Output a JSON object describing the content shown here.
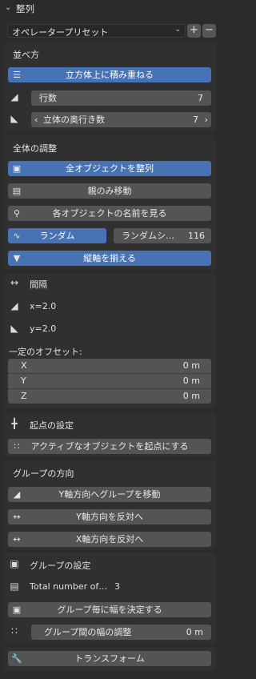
{
  "header": {
    "title": "整列",
    "chevron": "chevron-down-icon"
  },
  "preset": {
    "label": "オペレータープリセット",
    "add": "+",
    "remove": "−"
  },
  "arrange": {
    "title": "並べ方",
    "stack_button": "立方体上に積み重ねる",
    "rows_label": "行数",
    "rows_value": "7",
    "depth_label": "立体の奥行き数",
    "depth_value": "7",
    "depth_left": "‹",
    "depth_right": "›"
  },
  "overall": {
    "title": "全体の調整",
    "align_all": "全オブジェクトを整列",
    "parent_only": "親のみ移動",
    "show_names": "各オブジェクトの名前を見る",
    "random": "ランダム",
    "random_seed_label": "ランダムシ…",
    "random_seed_value": "116",
    "align_vertical": "縦軸を揃える"
  },
  "spacing": {
    "title": "間隔",
    "x": "x=2.0",
    "y": "y=2.0",
    "offset_title": "一定のオフセット:",
    "offsets": [
      {
        "axis": "X",
        "value": "0 m"
      },
      {
        "axis": "Y",
        "value": "0 m"
      },
      {
        "axis": "Z",
        "value": "0 m"
      }
    ]
  },
  "origin": {
    "title": "起点の設定",
    "active_origin": "アクティブなオブジェクトを起点にする"
  },
  "group_direction": {
    "title": "グループの方向",
    "move_y": "Y軸方向へグループを移動",
    "flip_y": "Y軸方向を反対へ",
    "flip_x": "X軸方向を反対へ"
  },
  "group_settings": {
    "title": "グループの設定",
    "total_label": "Total number of…",
    "total_value": "3",
    "width_per_group": "グループ毎に幅を決定する",
    "gap_label": "グループ間の幅の調整",
    "gap_value": "0 m"
  },
  "transform": {
    "label": "トランスフォーム"
  }
}
